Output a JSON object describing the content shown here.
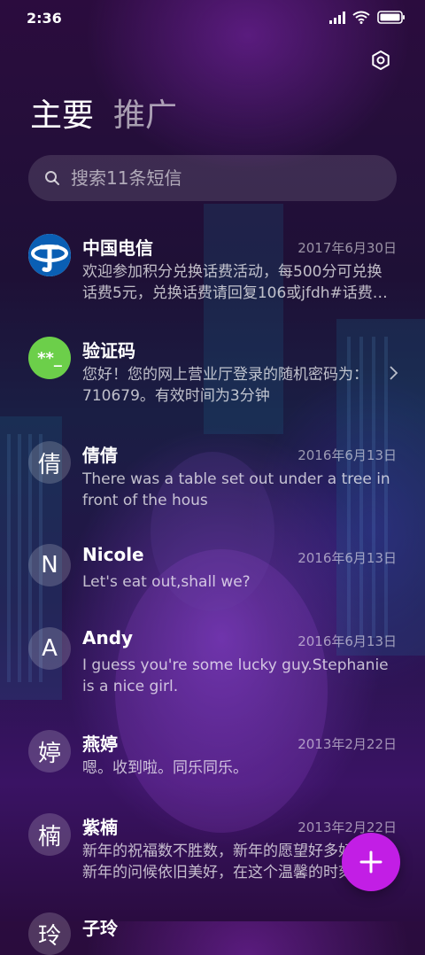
{
  "status_bar": {
    "time": "2:36"
  },
  "tabs": [
    {
      "label": "主要"
    },
    {
      "label": "推广"
    }
  ],
  "search": {
    "placeholder": "搜索11条短信"
  },
  "conversations": [
    {
      "name": "中国电信",
      "date": "2017年6月30日",
      "preview": "欢迎参加积分兑换话费活动，每500分可兑换话费5元，兑换话费请回复106或jfdh#话费…",
      "avatar": "china-telecom-logo"
    },
    {
      "name": "验证码",
      "date": "",
      "preview": "您好！您的网上营业厅登录的随机密码为：710679。有效时间为3分钟",
      "avatar_text": "**_",
      "avatar_color": "#6ccf4a"
    },
    {
      "name": "倩倩",
      "date": "2016年6月13日",
      "preview": "There was a table set out under a tree in front of the hous",
      "avatar_text": "倩"
    },
    {
      "name": "Nicole",
      "date": "2016年6月13日",
      "preview": "Let's eat out,shall we?",
      "avatar_text": "N"
    },
    {
      "name": "Andy",
      "date": "2016年6月13日",
      "preview": "I guess you're some lucky guy.Stephanie is a nice girl.",
      "avatar_text": "A"
    },
    {
      "name": "燕婷",
      "date": "2013年2月22日",
      "preview": "嗯。收到啦。同乐同乐。",
      "avatar_text": "婷"
    },
    {
      "name": "紫楠",
      "date": "2013年2月22日",
      "preview": "新年的祝福数不胜数，新年的愿望好多好多，新年的问候依旧美好，在这个温馨的时刻",
      "avatar_text": "楠"
    },
    {
      "name": "子玲",
      "date": "",
      "preview": "",
      "avatar_text": "玲"
    }
  ],
  "colors": {
    "fab": "#c21ee5",
    "verification_avatar": "#6ccf4a",
    "telecom_blue": "#0a5fb4"
  },
  "icons": {
    "settings": "settings-icon",
    "search": "search-icon",
    "compose": "plus-icon",
    "chevron": "chevron-right-icon"
  }
}
